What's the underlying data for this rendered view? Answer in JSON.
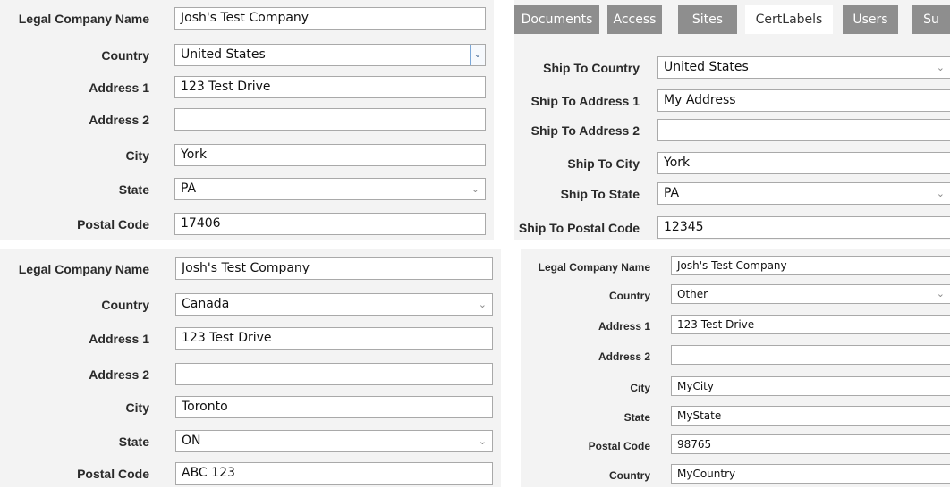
{
  "panel_top_left": {
    "rows": [
      {
        "label": "Legal Company Name",
        "value": "Josh's Test Company"
      },
      {
        "label": "Country",
        "value": "United States"
      },
      {
        "label": "Address 1",
        "value": "123 Test Drive"
      },
      {
        "label": "Address 2",
        "value": ""
      },
      {
        "label": "City",
        "value": "York"
      },
      {
        "label": "State",
        "value": "PA"
      },
      {
        "label": "Postal Code",
        "value": "17406"
      }
    ]
  },
  "tabs": [
    "Documents",
    "Access",
    "Sites",
    "CertLabels",
    "Users",
    "Su"
  ],
  "panel_top_right": {
    "rows": [
      {
        "label": "Ship To Country",
        "value": "United States"
      },
      {
        "label": "Ship To Address 1",
        "value": "My Address"
      },
      {
        "label": "Ship To Address 2",
        "value": ""
      },
      {
        "label": "Ship To City",
        "value": "York"
      },
      {
        "label": "Ship To State",
        "value": "PA"
      },
      {
        "label": "Ship To Postal Code",
        "value": "12345"
      }
    ]
  },
  "panel_bottom_left": {
    "rows": [
      {
        "label": "Legal Company Name",
        "value": "Josh's Test Company"
      },
      {
        "label": "Country",
        "value": "Canada"
      },
      {
        "label": "Address 1",
        "value": "123 Test Drive"
      },
      {
        "label": "Address 2",
        "value": ""
      },
      {
        "label": "City",
        "value": "Toronto"
      },
      {
        "label": "State",
        "value": "ON"
      },
      {
        "label": "Postal Code",
        "value": "ABC 123"
      }
    ]
  },
  "panel_bottom_right": {
    "rows": [
      {
        "label": "Legal Company Name",
        "value": "Josh's Test Company"
      },
      {
        "label": "Country",
        "value": "Other"
      },
      {
        "label": "Address 1",
        "value": "123 Test Drive"
      },
      {
        "label": "Address 2",
        "value": ""
      },
      {
        "label": "City",
        "value": "MyCity"
      },
      {
        "label": "State",
        "value": "MyState"
      },
      {
        "label": "Postal Code",
        "value": "98765"
      },
      {
        "label": "Country",
        "value": "MyCountry"
      }
    ]
  },
  "icons": {
    "dropdown": "chevron-down-icon"
  }
}
